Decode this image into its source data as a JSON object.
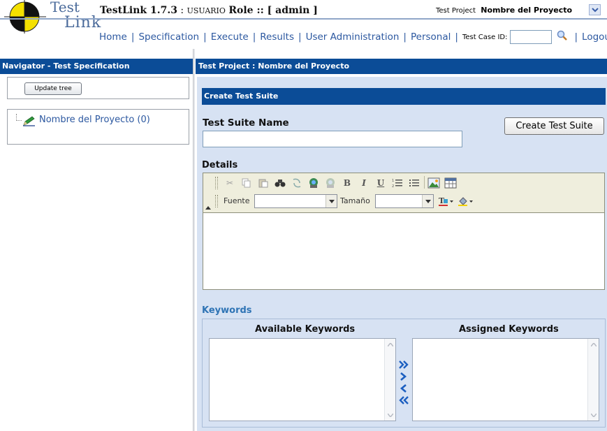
{
  "header": {
    "logo_top": "Test",
    "logo_bottom": "Link",
    "app_name": "TestLink 1.7.3",
    "title_sep": " : ",
    "user": "USUARIO",
    "role_text": "Role :: [ admin ]",
    "project_label": "Test Project",
    "project_name": "Nombre del Proyecto"
  },
  "nav": {
    "items": [
      "Home",
      "Specification",
      "Execute",
      "Results",
      "User Administration",
      "Personal"
    ],
    "test_case_label": "Test Case ID:",
    "test_case_value": "",
    "logout": "Logou"
  },
  "navigator": {
    "title": "Navigator - Test Specification",
    "update_button": "Update tree",
    "tree_root": "Nombre del Proyecto (0)"
  },
  "main": {
    "title": "Test Project : Nombre del Proyecto",
    "section_title": "Create Test Suite",
    "suite_name_label": "Test Suite Name",
    "suite_name_value": "",
    "create_button": "Create Test Suite",
    "details_label": "Details",
    "editor": {
      "font_label": "Fuente",
      "size_label": "Tamaño",
      "font_value": "",
      "size_value": ""
    },
    "keywords": {
      "label": "Keywords",
      "available_label": "Available Keywords",
      "assigned_label": "Assigned Keywords"
    }
  },
  "colors": {
    "header_bar": "#0b4c97",
    "link": "#2c58a0",
    "work_bg": "#d7e2f3",
    "keywords_label": "#2f74b5"
  }
}
